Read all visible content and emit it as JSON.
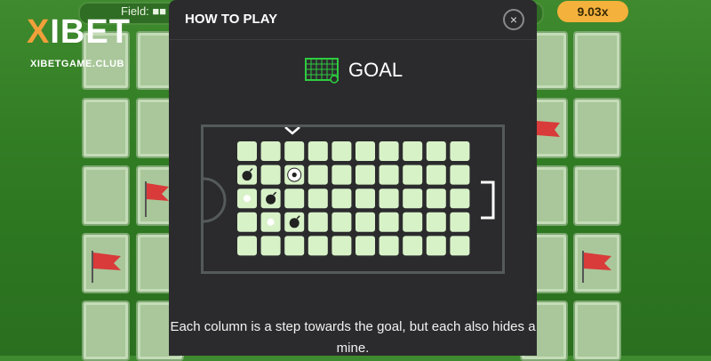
{
  "header": {
    "field_label": "Field: ■■",
    "multiplier": "9.03x"
  },
  "brand": {
    "logo_x": "X",
    "logo_rest": "IBET",
    "subtitle": "XIBETGAME.CLUB"
  },
  "modal": {
    "title": "HOW TO PLAY",
    "close_label": "×",
    "mode_icon": "goal-net-icon",
    "mode_name": "GOAL",
    "description": "Each column is a step towards the goal, but each also hides a mine."
  },
  "demo_grid": {
    "rows": 5,
    "cols": 10,
    "bombs": [
      [
        1,
        0
      ],
      [
        2,
        1
      ],
      [
        3,
        2
      ]
    ],
    "ball": [
      1,
      2
    ],
    "dots": [
      [
        2,
        0
      ],
      [
        3,
        1
      ]
    ]
  },
  "colors": {
    "pitch_green": "#3f8a2e",
    "tile": "#a9c79a",
    "demo_tile": "#d8f2c8",
    "multiplier_bg": "#f4b13c",
    "accent_green": "#2ecc40",
    "flag_red": "#d93a3a"
  }
}
